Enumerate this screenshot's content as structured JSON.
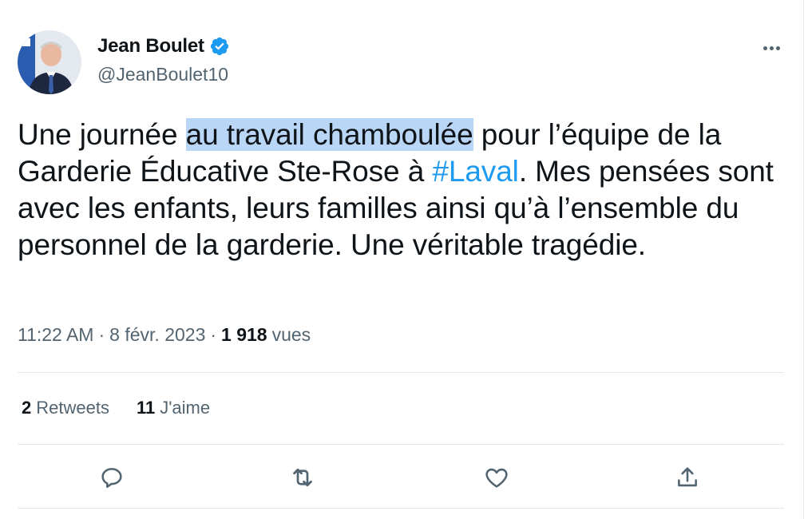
{
  "author": {
    "name": "Jean Boulet",
    "handle": "@JeanBoulet10",
    "verified": true
  },
  "tweet": {
    "text_before": "Une journée ",
    "text_highlight": "au travail chamboulée",
    "text_middle": " pour l’équipe de la Garderie Éducative Ste-Rose à ",
    "hashtag": "#Laval",
    "text_after": ". Mes pensées sont avec les enfants, leurs familles ainsi qu’à l’ensemble du personnel de la garderie. Une véritable tragédie."
  },
  "meta": {
    "time": "11:22 AM",
    "separator": "·",
    "date": "8 févr. 2023",
    "views_count": "1 918",
    "views_label": "vues"
  },
  "stats": {
    "retweets_count": "2",
    "retweets_label": "Retweets",
    "likes_count": "11",
    "likes_label": "J'aime"
  },
  "icons": {
    "more": "more-horizontal-icon",
    "reply": "reply-icon",
    "retweet": "retweet-icon",
    "like": "heart-icon",
    "share": "share-icon",
    "verified": "verified-badge-icon"
  },
  "colors": {
    "accent": "#1d9bf0",
    "highlight": "#bad6f7",
    "text": "#0f1419",
    "secondary": "#536471"
  }
}
